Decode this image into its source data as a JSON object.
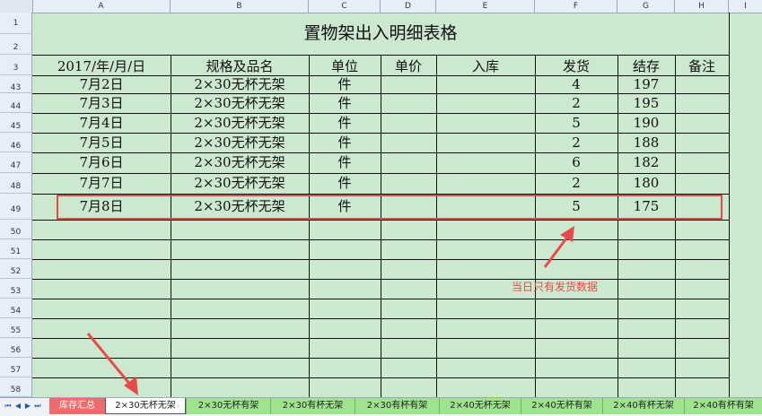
{
  "columns": [
    "A",
    "B",
    "C",
    "D",
    "E",
    "F",
    "G",
    "H",
    "I"
  ],
  "title": "置物架出入明细表格",
  "headers": [
    "2017/年/月/日",
    "规格及品名",
    "单位",
    "单价",
    "入库",
    "发货",
    "结存",
    "备注"
  ],
  "header_row_numbers": [
    "1",
    "2",
    "3"
  ],
  "rows": [
    {
      "num": "43",
      "date": "7月2日",
      "spec": "2×30无杯无架",
      "unit": "件",
      "price": "",
      "in": "",
      "out": "4",
      "stock": "197",
      "note": ""
    },
    {
      "num": "44",
      "date": "7月3日",
      "spec": "2×30无杯无架",
      "unit": "件",
      "price": "",
      "in": "",
      "out": "2",
      "stock": "195",
      "note": ""
    },
    {
      "num": "45",
      "date": "7月4日",
      "spec": "2×30无杯无架",
      "unit": "件",
      "price": "",
      "in": "",
      "out": "5",
      "stock": "190",
      "note": ""
    },
    {
      "num": "46",
      "date": "7月5日",
      "spec": "2×30无杯无架",
      "unit": "件",
      "price": "",
      "in": "",
      "out": "2",
      "stock": "188",
      "note": ""
    },
    {
      "num": "47",
      "date": "7月6日",
      "spec": "2×30无杯无架",
      "unit": "件",
      "price": "",
      "in": "",
      "out": "6",
      "stock": "182",
      "note": ""
    },
    {
      "num": "48",
      "date": "7月7日",
      "spec": "2×30无杯无架",
      "unit": "件",
      "price": "",
      "in": "",
      "out": "2",
      "stock": "180",
      "note": ""
    },
    {
      "num": "49",
      "date": "7月8日",
      "spec": "2×30无杯无架",
      "unit": "件",
      "price": "",
      "in": "",
      "out": "5",
      "stock": "175",
      "note": ""
    }
  ],
  "empty_row_numbers": [
    "50",
    "51",
    "52",
    "53",
    "54",
    "55",
    "56",
    "57",
    "58"
  ],
  "annotation": "当日只有发货数据",
  "tabs": [
    {
      "label": "库存汇总",
      "style": "red"
    },
    {
      "label": "2×30无杯无架",
      "style": "active"
    },
    {
      "label": "2×30无杯有架",
      "style": "green"
    },
    {
      "label": "2×30有杯无架",
      "style": "green"
    },
    {
      "label": "2×30有杯有架",
      "style": "green"
    },
    {
      "label": "2×40无杯无架",
      "style": "green"
    },
    {
      "label": "2×40无杯有架",
      "style": "green"
    },
    {
      "label": "2×40有杯无架",
      "style": "green"
    },
    {
      "label": "2×40有杯有架",
      "style": "green"
    }
  ],
  "colors": {
    "annotation": "#e84a4a",
    "sheet_bg": "#cce8cf",
    "tab_green": "#9fe28f"
  }
}
